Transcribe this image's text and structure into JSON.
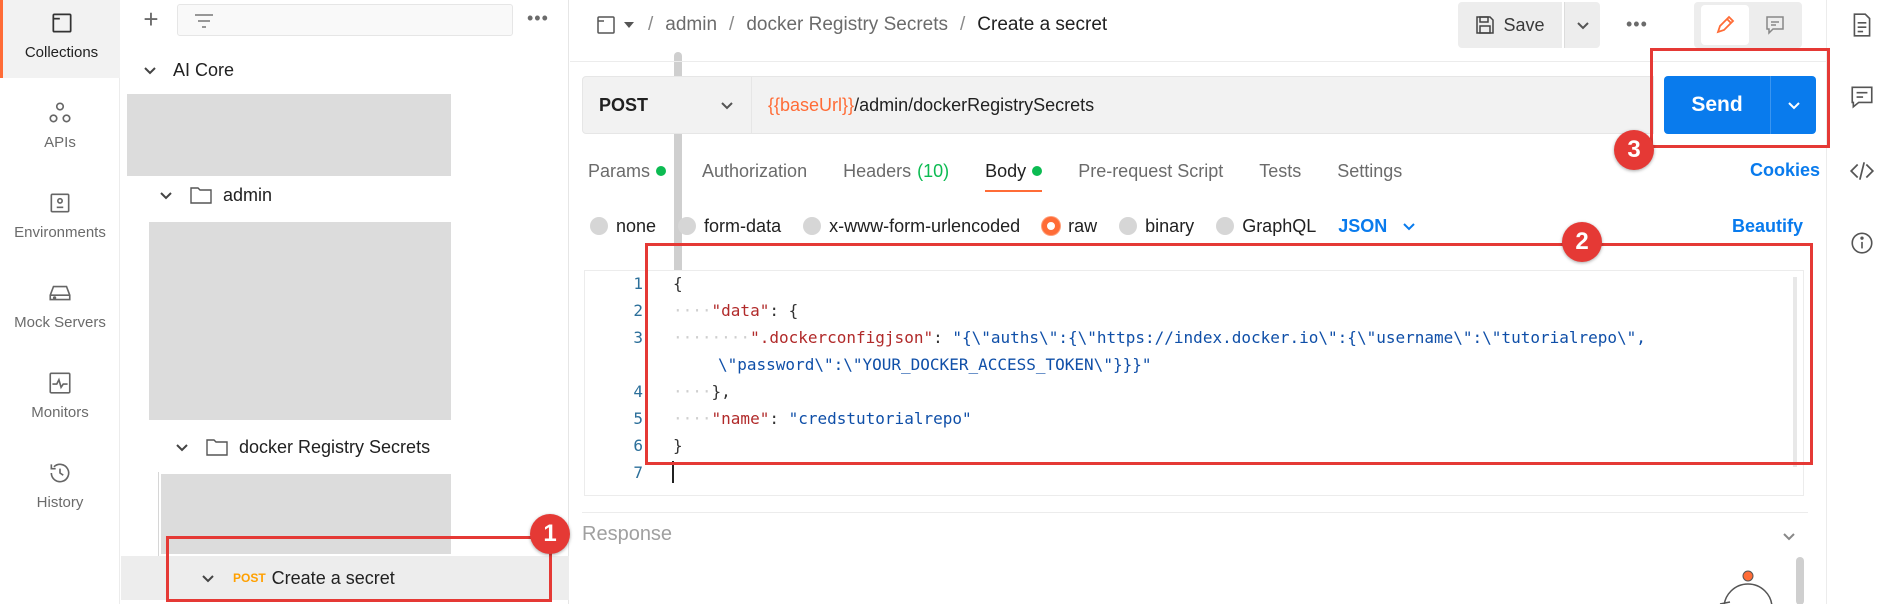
{
  "rail": {
    "items": [
      {
        "label": "Collections",
        "icon": "collections-icon"
      },
      {
        "label": "APIs",
        "icon": "apis-icon"
      },
      {
        "label": "Environments",
        "icon": "environments-icon"
      },
      {
        "label": "Mock Servers",
        "icon": "mock-servers-icon"
      },
      {
        "label": "Monitors",
        "icon": "monitors-icon"
      },
      {
        "label": "History",
        "icon": "history-icon"
      }
    ]
  },
  "sidebar": {
    "more": "•••",
    "tree": {
      "collection": "AI Core",
      "folder1": "admin",
      "folder2": "docker Registry Secrets",
      "request_method": "POST",
      "request_name": "Create a secret"
    }
  },
  "breadcrumb": {
    "items": [
      "admin",
      "docker Registry Secrets"
    ],
    "current": "Create a secret",
    "sep": "/"
  },
  "toolbar": {
    "save_label": "Save",
    "more": "•••"
  },
  "request": {
    "method": "POST",
    "url_var": "{{baseUrl}}",
    "url_path": "/admin/dockerRegistrySecrets",
    "send_label": "Send"
  },
  "tabs": {
    "params": "Params",
    "authorization": "Authorization",
    "headers": "Headers",
    "headers_count": "(10)",
    "body": "Body",
    "prerequest": "Pre-request Script",
    "tests": "Tests",
    "settings": "Settings",
    "cookies": "Cookies"
  },
  "bodytypes": {
    "none": "none",
    "formdata": "form-data",
    "urlencoded": "x-www-form-urlencoded",
    "raw": "raw",
    "binary": "binary",
    "graphql": "GraphQL",
    "format": "JSON",
    "beautify": "Beautify",
    "selected": "raw"
  },
  "editor": {
    "line_numbers": [
      "1",
      "2",
      "3",
      "",
      "4",
      "5",
      "6",
      "7"
    ],
    "l1": "{",
    "l2_key": "\"data\"",
    "l2_rest": ": {",
    "l3_key": "\".dockerconfigjson\"",
    "l3_colon": ": ",
    "l3_val": "\"{\\\"auths\\\":{\\\"https://index.docker.io\\\":{\\\"username\\\":\\\"tutorialrepo\\\",",
    "l3b_val": "\\\"password\\\":\\\"YOUR_DOCKER_ACCESS_TOKEN\\\"}}}\"",
    "l4": "},",
    "l5_key": "\"name\"",
    "l5_colon": ": ",
    "l5_val": "\"credstutorialrepo\"",
    "l6": "}"
  },
  "response": {
    "title": "Response"
  },
  "annotations": [
    "1",
    "2",
    "3"
  ],
  "colors": {
    "accent": "#ff6c37",
    "primary": "#097bed",
    "success": "#0cbb52",
    "annotation": "#e53935",
    "method_post": "#ffa000"
  }
}
